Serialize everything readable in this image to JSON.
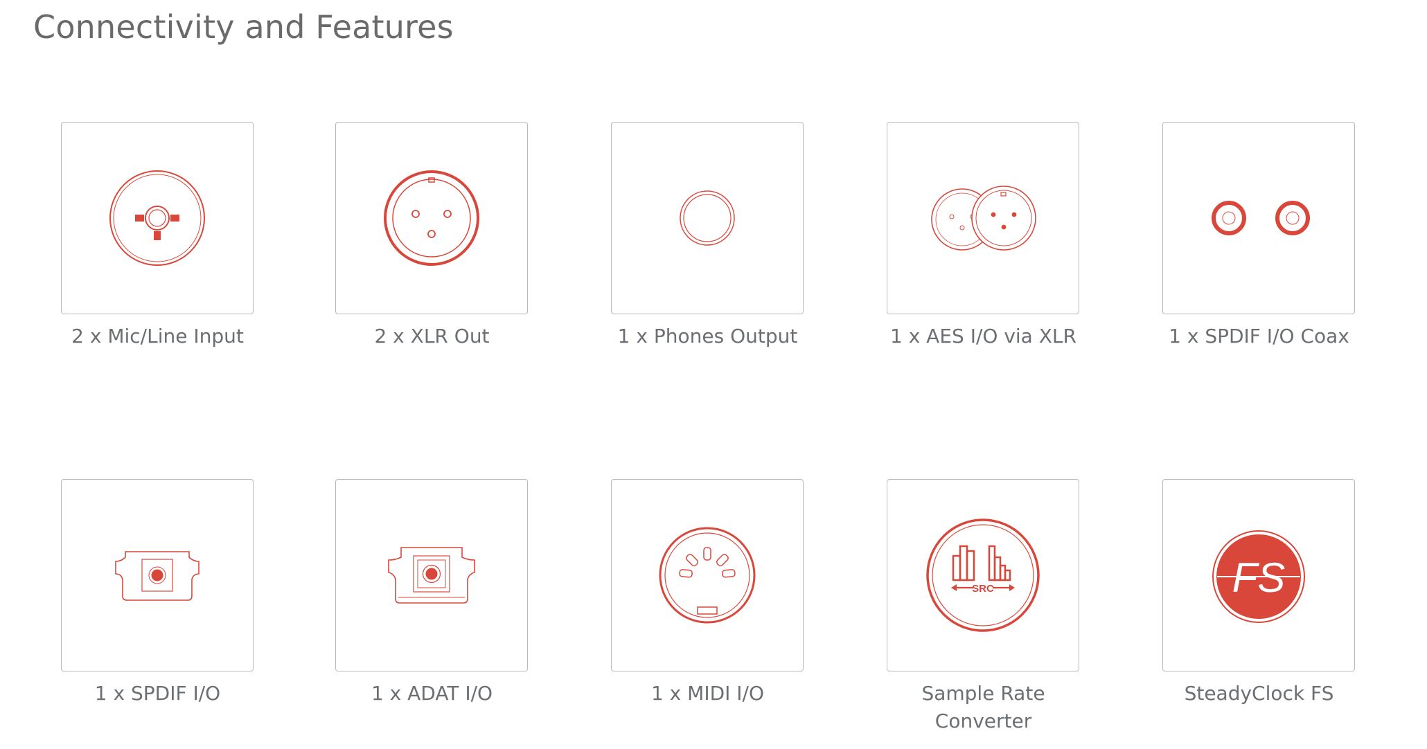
{
  "page": {
    "title": "Connectivity and Features"
  },
  "colors": {
    "accent": "#d9473b",
    "tile_border": "#b9b9b9",
    "label_text": "#6b6f73",
    "title_text": "#6a6a6a"
  },
  "features": [
    {
      "icon": "combo-jack-icon",
      "label": "2 x Mic/Line Input"
    },
    {
      "icon": "xlr-connector-icon",
      "label": "2 x XLR Out"
    },
    {
      "icon": "phones-jack-icon",
      "label": "1 x Phones Output"
    },
    {
      "icon": "aes-xlr-pair-icon",
      "label": "1 x AES I/O via XLR"
    },
    {
      "icon": "rca-coax-pair-icon",
      "label": "1 x SPDIF I/O Coax"
    },
    {
      "icon": "optical-toslink-icon",
      "label": "1 x SPDIF I/O"
    },
    {
      "icon": "adat-optical-icon",
      "label": "1 x ADAT I/O"
    },
    {
      "icon": "midi-din-icon",
      "label": "1 x MIDI I/O"
    },
    {
      "icon": "sample-rate-converter-icon",
      "label_lines": [
        "Sample Rate",
        "Converter"
      ],
      "badge": "SRC"
    },
    {
      "icon": "steadyclock-fs-icon",
      "label": "SteadyClock FS",
      "badge": "FS"
    }
  ]
}
